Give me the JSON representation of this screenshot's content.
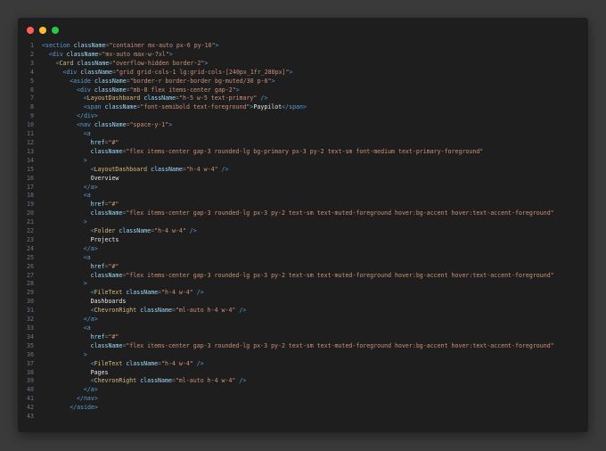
{
  "window": {
    "controls": [
      "close",
      "minimize",
      "maximize"
    ],
    "colors": {
      "close": "#ff5f57",
      "minimize": "#febc2e",
      "maximize": "#28c840"
    }
  },
  "code_lines": [
    {
      "n": "1",
      "indent": 0,
      "tokens": [
        [
          "tag",
          "<section "
        ],
        [
          "attr",
          "className"
        ],
        [
          "punc",
          "="
        ],
        [
          "str",
          "\"container mx-auto px-6 py-16\""
        ],
        [
          "tag",
          ">"
        ]
      ]
    },
    {
      "n": "2",
      "indent": 1,
      "tokens": [
        [
          "tag",
          "<div "
        ],
        [
          "attr",
          "className"
        ],
        [
          "punc",
          "="
        ],
        [
          "str",
          "\"mx-auto max-w-7xl\""
        ],
        [
          "tag",
          ">"
        ]
      ]
    },
    {
      "n": "3",
      "indent": 2,
      "tokens": [
        [
          "tag",
          "<"
        ],
        [
          "comp",
          "Card "
        ],
        [
          "attr",
          "className"
        ],
        [
          "punc",
          "="
        ],
        [
          "str",
          "\"overflow-hidden border-2\""
        ],
        [
          "tag",
          ">"
        ]
      ]
    },
    {
      "n": "4",
      "indent": 3,
      "tokens": [
        [
          "tag",
          "<div "
        ],
        [
          "attr",
          "className"
        ],
        [
          "punc",
          "="
        ],
        [
          "str",
          "\"grid grid-cols-1 lg:grid-cols-[240px_1fr_280px]\""
        ],
        [
          "tag",
          ">"
        ]
      ]
    },
    {
      "n": "5",
      "indent": 4,
      "tokens": [
        [
          "tag",
          "<aside "
        ],
        [
          "attr",
          "className"
        ],
        [
          "punc",
          "="
        ],
        [
          "str",
          "\"border-r border-border bg-muted/30 p-6\""
        ],
        [
          "tag",
          ">"
        ]
      ]
    },
    {
      "n": "6",
      "indent": 5,
      "tokens": [
        [
          "tag",
          "<div "
        ],
        [
          "attr",
          "className"
        ],
        [
          "punc",
          "="
        ],
        [
          "str",
          "\"mb-8 flex items-center gap-2\""
        ],
        [
          "tag",
          ">"
        ]
      ]
    },
    {
      "n": "7",
      "indent": 6,
      "tokens": [
        [
          "tag",
          "<"
        ],
        [
          "comp",
          "LayoutDashboard "
        ],
        [
          "attr",
          "className"
        ],
        [
          "punc",
          "="
        ],
        [
          "str",
          "\"h-5 w-5 text-primary\""
        ],
        [
          "tag",
          " />"
        ]
      ]
    },
    {
      "n": "8",
      "indent": 6,
      "tokens": [
        [
          "tag",
          "<span "
        ],
        [
          "attr",
          "className"
        ],
        [
          "punc",
          "="
        ],
        [
          "str",
          "\"font-semibold text-foreground\""
        ],
        [
          "tag",
          ">"
        ],
        [
          "txt",
          "Paypilot"
        ],
        [
          "tag",
          "</span>"
        ]
      ]
    },
    {
      "n": "9",
      "indent": 5,
      "tokens": [
        [
          "tag",
          "</div>"
        ]
      ]
    },
    {
      "n": "10",
      "indent": 5,
      "tokens": [
        [
          "tag",
          "<nav "
        ],
        [
          "attr",
          "className"
        ],
        [
          "punc",
          "="
        ],
        [
          "str",
          "\"space-y-1\""
        ],
        [
          "tag",
          ">"
        ]
      ]
    },
    {
      "n": "11",
      "indent": 6,
      "tokens": [
        [
          "tag",
          "<a"
        ]
      ]
    },
    {
      "n": "12",
      "indent": 7,
      "tokens": [
        [
          "attr",
          "href"
        ],
        [
          "punc",
          "="
        ],
        [
          "str",
          "\"#\""
        ]
      ]
    },
    {
      "n": "13",
      "indent": 7,
      "tokens": [
        [
          "attr",
          "className"
        ],
        [
          "punc",
          "="
        ],
        [
          "str",
          "\"flex items-center gap-3 rounded-lg bg-primary px-3 py-2 text-sm font-medium text-primary-foreground\""
        ]
      ]
    },
    {
      "n": "14",
      "indent": 6,
      "tokens": [
        [
          "tag",
          ">"
        ]
      ]
    },
    {
      "n": "15",
      "indent": 7,
      "tokens": [
        [
          "tag",
          "<"
        ],
        [
          "comp",
          "LayoutDashboard "
        ],
        [
          "attr",
          "className"
        ],
        [
          "punc",
          "="
        ],
        [
          "str",
          "\"h-4 w-4\""
        ],
        [
          "tag",
          " />"
        ]
      ]
    },
    {
      "n": "16",
      "indent": 7,
      "tokens": [
        [
          "txt",
          "Overview"
        ]
      ]
    },
    {
      "n": "17",
      "indent": 6,
      "tokens": [
        [
          "tag",
          "</a>"
        ]
      ]
    },
    {
      "n": "18",
      "indent": 6,
      "tokens": [
        [
          "tag",
          "<a"
        ]
      ]
    },
    {
      "n": "19",
      "indent": 7,
      "tokens": [
        [
          "attr",
          "href"
        ],
        [
          "punc",
          "="
        ],
        [
          "str",
          "\"#\""
        ]
      ]
    },
    {
      "n": "20",
      "indent": 7,
      "tokens": [
        [
          "attr",
          "className"
        ],
        [
          "punc",
          "="
        ],
        [
          "str",
          "\"flex items-center gap-3 rounded-lg px-3 py-2 text-sm text-muted-foreground hover:bg-accent hover:text-accent-foreground\""
        ]
      ]
    },
    {
      "n": "21",
      "indent": 6,
      "tokens": [
        [
          "tag",
          ">"
        ]
      ]
    },
    {
      "n": "22",
      "indent": 7,
      "tokens": [
        [
          "tag",
          "<"
        ],
        [
          "comp",
          "Folder "
        ],
        [
          "attr",
          "className"
        ],
        [
          "punc",
          "="
        ],
        [
          "str",
          "\"h-4 w-4\""
        ],
        [
          "tag",
          " />"
        ]
      ]
    },
    {
      "n": "23",
      "indent": 7,
      "tokens": [
        [
          "txt",
          "Projects"
        ]
      ]
    },
    {
      "n": "24",
      "indent": 6,
      "tokens": [
        [
          "tag",
          "</a>"
        ]
      ]
    },
    {
      "n": "25",
      "indent": 6,
      "tokens": [
        [
          "tag",
          "<a"
        ]
      ]
    },
    {
      "n": "26",
      "indent": 7,
      "tokens": [
        [
          "attr",
          "href"
        ],
        [
          "punc",
          "="
        ],
        [
          "str",
          "\"#\""
        ]
      ]
    },
    {
      "n": "27",
      "indent": 7,
      "tokens": [
        [
          "attr",
          "className"
        ],
        [
          "punc",
          "="
        ],
        [
          "str",
          "\"flex items-center gap-3 rounded-lg px-3 py-2 text-sm text-muted-foreground hover:bg-accent hover:text-accent-foreground\""
        ]
      ]
    },
    {
      "n": "28",
      "indent": 6,
      "tokens": [
        [
          "tag",
          ">"
        ]
      ]
    },
    {
      "n": "29",
      "indent": 7,
      "tokens": [
        [
          "tag",
          "<"
        ],
        [
          "comp",
          "FileText "
        ],
        [
          "attr",
          "className"
        ],
        [
          "punc",
          "="
        ],
        [
          "str",
          "\"h-4 w-4\""
        ],
        [
          "tag",
          " />"
        ]
      ]
    },
    {
      "n": "30",
      "indent": 7,
      "tokens": [
        [
          "txt",
          "Dashboards"
        ]
      ]
    },
    {
      "n": "31",
      "indent": 7,
      "tokens": [
        [
          "tag",
          "<"
        ],
        [
          "comp",
          "ChevronRight "
        ],
        [
          "attr",
          "className"
        ],
        [
          "punc",
          "="
        ],
        [
          "str",
          "\"ml-auto h-4 w-4\""
        ],
        [
          "tag",
          " />"
        ]
      ]
    },
    {
      "n": "32",
      "indent": 6,
      "tokens": [
        [
          "tag",
          "</a>"
        ]
      ]
    },
    {
      "n": "33",
      "indent": 6,
      "tokens": [
        [
          "tag",
          "<a"
        ]
      ]
    },
    {
      "n": "34",
      "indent": 7,
      "tokens": [
        [
          "attr",
          "href"
        ],
        [
          "punc",
          "="
        ],
        [
          "str",
          "\"#\""
        ]
      ]
    },
    {
      "n": "35",
      "indent": 7,
      "tokens": [
        [
          "attr",
          "className"
        ],
        [
          "punc",
          "="
        ],
        [
          "str",
          "\"flex items-center gap-3 rounded-lg px-3 py-2 text-sm text-muted-foreground hover:bg-accent hover:text-accent-foreground\""
        ]
      ]
    },
    {
      "n": "36",
      "indent": 6,
      "tokens": [
        [
          "tag",
          ">"
        ]
      ]
    },
    {
      "n": "37",
      "indent": 7,
      "tokens": [
        [
          "tag",
          "<"
        ],
        [
          "comp",
          "FileText "
        ],
        [
          "attr",
          "className"
        ],
        [
          "punc",
          "="
        ],
        [
          "str",
          "\"h-4 w-4\""
        ],
        [
          "tag",
          " />"
        ]
      ]
    },
    {
      "n": "38",
      "indent": 7,
      "tokens": [
        [
          "txt",
          "Pages"
        ]
      ]
    },
    {
      "n": "39",
      "indent": 7,
      "tokens": [
        [
          "tag",
          "<"
        ],
        [
          "comp",
          "ChevronRight "
        ],
        [
          "attr",
          "className"
        ],
        [
          "punc",
          "="
        ],
        [
          "str",
          "\"ml-auto h-4 w-4\""
        ],
        [
          "tag",
          " />"
        ]
      ]
    },
    {
      "n": "40",
      "indent": 6,
      "tokens": [
        [
          "tag",
          "</a>"
        ]
      ]
    },
    {
      "n": "41",
      "indent": 5,
      "tokens": [
        [
          "tag",
          "</nav>"
        ]
      ]
    },
    {
      "n": "42",
      "indent": 4,
      "tokens": [
        [
          "tag",
          "</aside>"
        ]
      ]
    },
    {
      "n": "43",
      "indent": 0,
      "tokens": []
    }
  ]
}
